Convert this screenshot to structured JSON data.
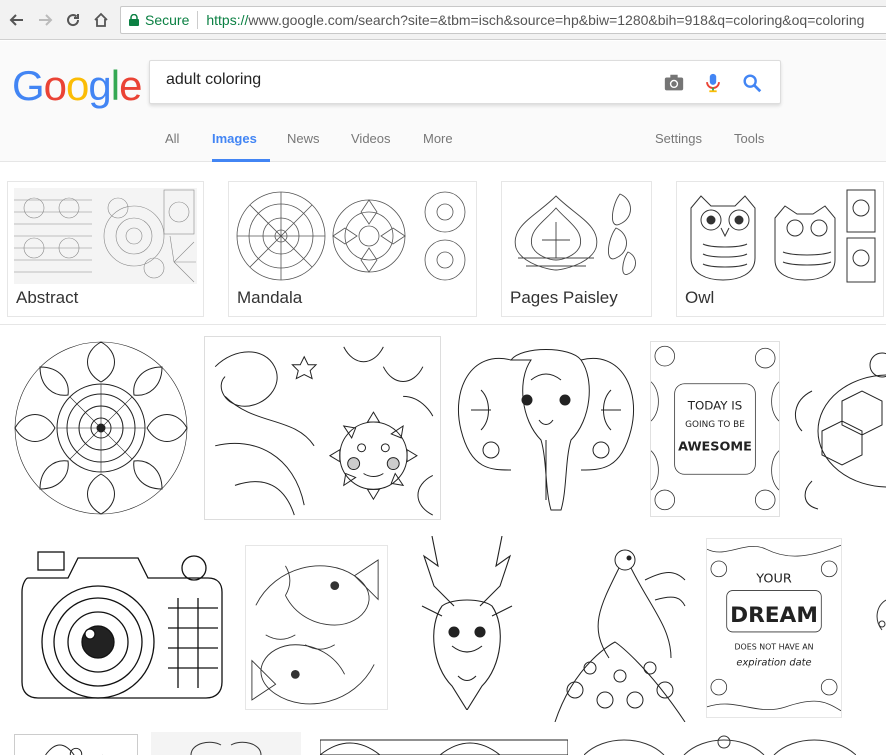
{
  "browser": {
    "secure_label": "Secure",
    "url_scheme": "https://",
    "url_rest": "www.google.com/search?site=&tbm=isch&source=hp&biw=1280&bih=918&q=coloring&oq=coloring"
  },
  "logo": [
    "G",
    "o",
    "o",
    "g",
    "l",
    "e"
  ],
  "colors": {
    "logo": [
      "#4285f4",
      "#ea4335",
      "#fbbc05",
      "#4285f4",
      "#34a853",
      "#ea4335"
    ],
    "active_tab": "#4285f4",
    "secure": "#0b8043"
  },
  "search": {
    "query": "adult coloring"
  },
  "tabs": {
    "all": "All",
    "images": "Images",
    "news": "News",
    "videos": "Videos",
    "more": "More",
    "settings": "Settings",
    "tools": "Tools"
  },
  "related": [
    {
      "label": "Abstract",
      "icon": "abstract-pattern"
    },
    {
      "label": "Mandala",
      "icon": "mandala"
    },
    {
      "label": "Pages Paisley",
      "icon": "paisley"
    },
    {
      "label": "Owl",
      "icon": "owl"
    }
  ],
  "results": {
    "today_text": [
      "TODAY IS",
      "GOING TO BE",
      "AWESOME"
    ],
    "dream_text": [
      "YOUR",
      "DREAM",
      "DOES NOT HAVE AN",
      "expiration date"
    ]
  }
}
